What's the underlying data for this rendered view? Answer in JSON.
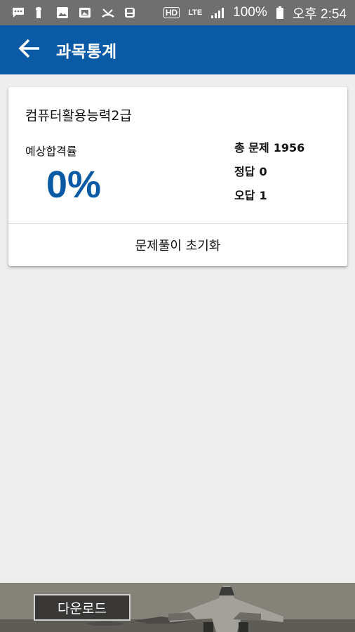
{
  "status_bar": {
    "icons": [
      "message-icon",
      "notification-icon",
      "image-icon",
      "gallery-icon",
      "missed-call-icon",
      "save-icon",
      "hd-icon",
      "lte-icon",
      "signal-icon",
      "battery-icon"
    ],
    "hd_label": "HD",
    "lte_label": "LTE",
    "battery": "100%",
    "time": "오후 2:54"
  },
  "app_bar": {
    "title": "과목통계",
    "color": "#0a5aa5"
  },
  "card": {
    "subject": "컴퓨터활용능력2급",
    "rate_label": "예상합격률",
    "rate_value": "0%",
    "total_label": "총 문제",
    "total_value": "1956",
    "correct_label": "정답",
    "correct_value": "0",
    "wrong_label": "오답",
    "wrong_value": "1",
    "reset_button": "문제풀이 초기화"
  },
  "ad": {
    "download_label": "다운로드"
  }
}
